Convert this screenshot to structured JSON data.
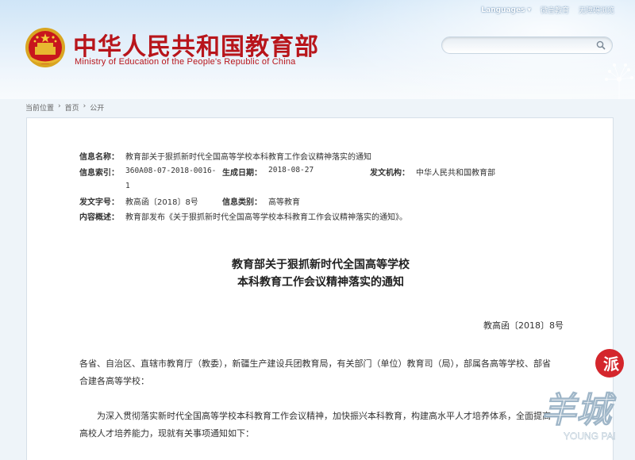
{
  "header": {
    "top_links": {
      "languages": "Languages",
      "weibo": "微言教育",
      "accessibility": "无障碍浏览"
    },
    "title": "中华人民共和国教育部",
    "subtitle": "Ministry of Education of the People's Republic of China",
    "search": {
      "placeholder": ""
    }
  },
  "breadcrumb": {
    "current_label": "当前位置",
    "home": "首页",
    "separator": "›",
    "section": "公开"
  },
  "meta": {
    "info_name_label": "信息名称：",
    "info_name": "教育部关于狠抓新时代全国高等学校本科教育工作会议精神落实的通知",
    "index_label": "信息索引：",
    "index_line1": "360A08-07-2018-0016-",
    "index_line2": "1",
    "date_label": "生成日期：",
    "date": "2018-08-27",
    "issuer_label": "发文机构：",
    "issuer": "中华人民共和国教育部",
    "doc_no_label": "发文字号：",
    "doc_no": "教高函〔2018〕8号",
    "category_label": "信息类别：",
    "category": "高等教育",
    "summary_label": "内容概述：",
    "summary": "教育部发布《关于狠抓新时代全国高等学校本科教育工作会议精神落实的通知》。"
  },
  "document": {
    "title_line1": "教育部关于狠抓新时代全国高等学校",
    "title_line2": "本科教育工作会议精神落实的通知",
    "number": "教高函〔2018〕8号",
    "para1": "各省、自治区、直辖市教育厅（教委），新疆生产建设兵团教育局，有关部门（单位）教育司（局），部属各高等学校、部省合建各高等学校：",
    "para2": "为深入贯彻落实新时代全国高等学校本科教育工作会议精神，加快振兴本科教育，构建高水平人才培养体系，全面提高高校人才培养能力，现就有关事项通知如下："
  },
  "watermark": {
    "text_pai": "派",
    "text_yangcheng": "羊城",
    "text_en": "YOUNG PAI"
  },
  "colors": {
    "brand_red": "#b8151b",
    "header_blue": "#cfe5f7"
  }
}
